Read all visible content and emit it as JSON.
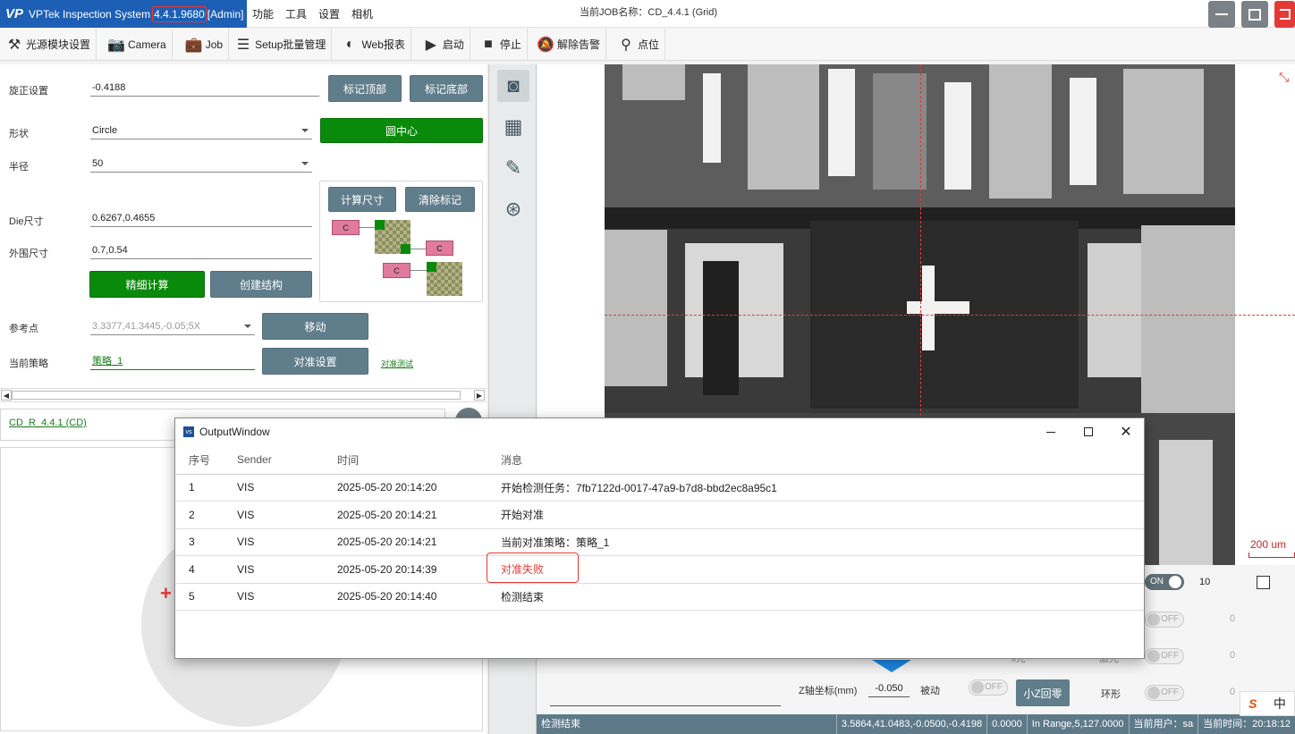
{
  "titlebar": {
    "logo": "VP",
    "app_name": "VPTek Inspection System",
    "version": "4.4.1.9680",
    "role": "[Admin]",
    "menu": [
      "功能",
      "工具",
      "设置",
      "相机"
    ],
    "job_title": "当前JOB名称：CD_4.4.1 (Grid)"
  },
  "toolbar": {
    "items": [
      {
        "label": "光源模块设置",
        "icon": "light-module-icon"
      },
      {
        "label": "Camera",
        "icon": "camera-icon"
      },
      {
        "label": "Job",
        "icon": "briefcase-icon"
      },
      {
        "label": "Setup批量管理",
        "icon": "checklist-icon"
      },
      {
        "label": "Web报表",
        "icon": "web-report-icon"
      },
      {
        "label": "启动",
        "icon": "play-icon"
      },
      {
        "label": "停止",
        "icon": "stop-icon"
      },
      {
        "label": "解除告警",
        "icon": "bell-off-icon"
      },
      {
        "label": "点位",
        "icon": "location-pin-icon"
      }
    ]
  },
  "left": {
    "rotation_label": "旋正设置",
    "rotation_value": "-0.4188",
    "mark_top": "标记顶部",
    "mark_bottom": "标记底部",
    "shape_label": "形状",
    "shape_value": "Circle",
    "circle_center": "圆中心",
    "radius_label": "半径",
    "radius_value": "50",
    "calc_size": "计算尺寸",
    "clear_marks": "清除标记",
    "die_label": "Die尺寸",
    "die_value": "0.6267,0.4655",
    "outer_label": "外围尺寸",
    "outer_value": "0.7,0.54",
    "fine_calc": "精细计算",
    "create_struct": "创建结构",
    "ref_label": "参考点",
    "ref_value": "3.3377,41.3445,-0.05;5X",
    "move": "移动",
    "strategy_label": "当前策略",
    "strategy_value": "策略_1",
    "align_settings": "对准设置",
    "align_test": "对准测试",
    "diagram_label": "C",
    "job_tab": "CD_R_4.4.1 (CD)"
  },
  "viewer": {
    "scale_label": "200 um"
  },
  "controls": {
    "row1_toggle": "ON",
    "row1_value": "10",
    "row2_toggle": "OFF",
    "row2_value": "0",
    "row3_label_a": "ii光",
    "row3_label_b": "激光",
    "row3_toggle": "OFF",
    "row3_value": "0",
    "z_label": "Z轴坐标(mm)",
    "z_value": "-0.050",
    "passive_label": "被动",
    "passive_toggle": "OFF",
    "z_home": "小Z回零",
    "ring_label": "环形",
    "ring_toggle": "OFF",
    "ring_value": "0"
  },
  "status": {
    "message": "检测结束",
    "position": "3.5864,41.0483,-0.0500,-0.4198",
    "value": "0.0000",
    "range": "In Range,5,127.0000",
    "user": "当前用户：sa",
    "time": "当前时间：20:18:12"
  },
  "ime": {
    "logo": "S",
    "lang": "中"
  },
  "output_window": {
    "title": "OutputWindow",
    "columns": [
      "序号",
      "Sender",
      "时间",
      "消息"
    ],
    "rows": [
      {
        "no": "1",
        "sender": "VIS",
        "time": "2025-05-20 20:14:20",
        "message": "开始检测任务：7fb7122d-0017-47a9-b7d8-bbd2ec8a95c1"
      },
      {
        "no": "2",
        "sender": "VIS",
        "time": "2025-05-20 20:14:21",
        "message": "开始对准"
      },
      {
        "no": "3",
        "sender": "VIS",
        "time": "2025-05-20 20:14:21",
        "message": "当前对准策略：策略_1"
      },
      {
        "no": "4",
        "sender": "VIS",
        "time": "2025-05-20 20:14:39",
        "message": "对准失败"
      },
      {
        "no": "5",
        "sender": "VIS",
        "time": "2025-05-20 20:14:40",
        "message": "检测结束"
      }
    ]
  },
  "colors": {
    "accent_blue": "#1d5fb5",
    "slate_button": "#607d8b",
    "green_button": "#0a8a0a",
    "alert_red": "#e53935",
    "status_bar": "#5e7a89"
  }
}
